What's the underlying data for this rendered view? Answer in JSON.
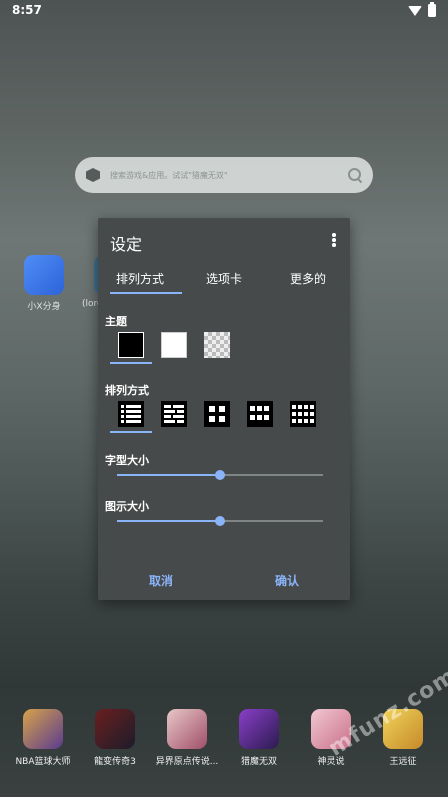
{
  "status_bar": {
    "time": "8:57"
  },
  "search": {
    "placeholder": "搜索游戏&应用。试试\"猎魔无双\""
  },
  "home_icons": [
    {
      "label": "小X分身"
    },
    {
      "label": "(lord"
    }
  ],
  "dock": [
    {
      "label": "NBA篮球大师"
    },
    {
      "label": "龍变传奇3"
    },
    {
      "label": "异界原点传说..."
    },
    {
      "label": "猎魔无双"
    },
    {
      "label": "神灵说"
    },
    {
      "label": "王远征"
    }
  ],
  "watermark": "mfunz.com 魔趣网",
  "dialog": {
    "title": "设定",
    "tabs": [
      "排列方式",
      "选项卡",
      "更多的"
    ],
    "active_tab": 0,
    "theme_label": "主题",
    "layout_label": "排列方式",
    "font_size_label": "字型大小",
    "icon_size_label": "图示大小",
    "font_size_value": 0.5,
    "icon_size_value": 0.5,
    "cancel_label": "取消",
    "confirm_label": "确认",
    "accent_color": "#8ab4f8",
    "themes": [
      "black",
      "white",
      "transparent"
    ],
    "selected_theme": 0,
    "selected_layout": 0
  }
}
